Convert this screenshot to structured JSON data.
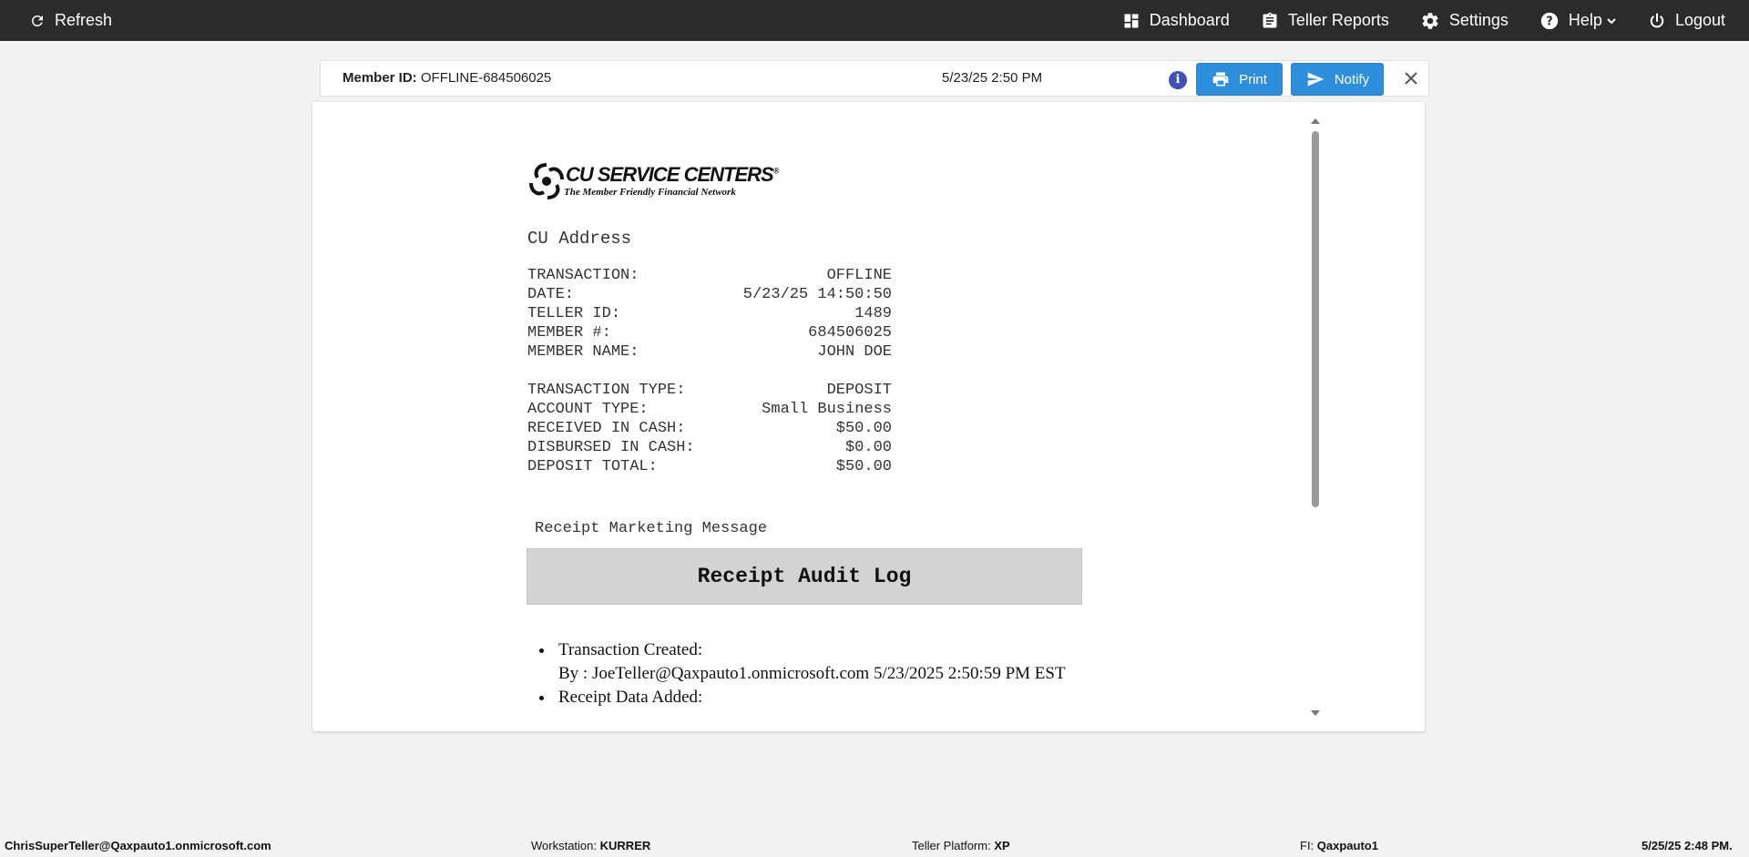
{
  "topbar": {
    "refresh_label": "Refresh",
    "nav": {
      "dashboard": "Dashboard",
      "teller_reports": "Teller Reports",
      "settings": "Settings",
      "help": "Help",
      "logout": "Logout"
    }
  },
  "header": {
    "member_id_label": "Member ID:",
    "member_id_value": "OFFLINE-684506025",
    "datetime": "5/23/25 2:50 PM",
    "info_glyph": "i",
    "print_label": "Print",
    "notify_label": "Notify"
  },
  "receipt": {
    "logo_title": "CU SERVICE CENTERS",
    "logo_registered": "®",
    "logo_tagline": "The Member Friendly Financial Network",
    "cu_address": "CU Address",
    "block1": [
      {
        "label": "TRANSACTION:",
        "value": "OFFLINE"
      },
      {
        "label": "DATE:",
        "value": "5/23/25 14:50:50"
      },
      {
        "label": "TELLER ID:",
        "value": "1489"
      },
      {
        "label": "MEMBER #:",
        "value": "684506025"
      },
      {
        "label": "MEMBER NAME:",
        "value": "JOHN DOE"
      }
    ],
    "block2": [
      {
        "label": "TRANSACTION TYPE:",
        "value": "DEPOSIT"
      },
      {
        "label": "ACCOUNT TYPE:",
        "value": "Small Business"
      },
      {
        "label": "RECEIVED IN CASH:",
        "value": "$50.00"
      },
      {
        "label": "DISBURSED IN CASH:",
        "value": "$0.00"
      },
      {
        "label": "DEPOSIT TOTAL:",
        "value": "$50.00"
      }
    ],
    "marketing_message": "Receipt Marketing Message",
    "audit_title": "Receipt Audit Log",
    "audit_items": [
      {
        "title": "Transaction Created:",
        "detail": "By : JoeTeller@Qaxpauto1.onmicrosoft.com 5/23/2025 2:50:59 PM EST"
      },
      {
        "title": "Receipt Data Added:",
        "detail": ""
      }
    ]
  },
  "footer": {
    "user": "ChrisSuperTeller@Qaxpauto1.onmicrosoft.com",
    "workstation_label": "Workstation:",
    "workstation_value": "KURRER",
    "platform_label": "Teller Platform:",
    "platform_value": "XP",
    "fi_label": "FI:",
    "fi_value": "Qaxpauto1",
    "datetime": "5/25/25 2:48 PM."
  },
  "colors": {
    "topbar_bg": "#2b2b2b",
    "primary_button": "#2d8fdc",
    "info_icon": "#3f51b5",
    "audit_box_bg": "#d3d3d3"
  }
}
